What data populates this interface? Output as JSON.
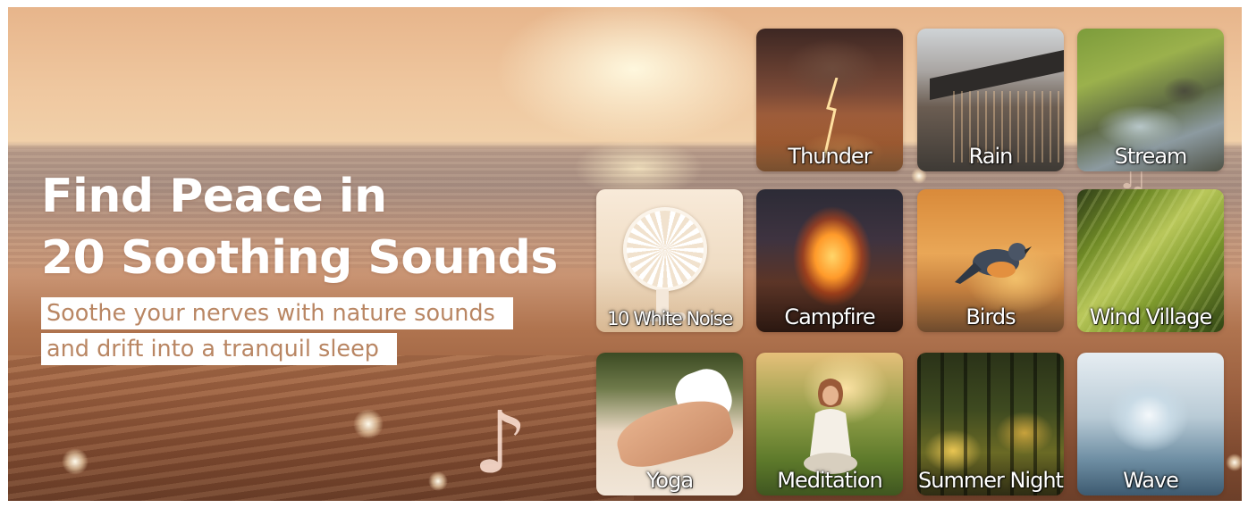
{
  "headline": {
    "line1": "Find Peace in",
    "line2": "20 Soothing Sounds"
  },
  "subtitle": {
    "line1": "Soothe your nerves with nature sounds",
    "line2": "and drift into a tranquil sleep"
  },
  "tiles": [
    {
      "label": "Thunder",
      "icon": "thunder-icon"
    },
    {
      "label": "Rain",
      "icon": "rain-icon"
    },
    {
      "label": "Stream",
      "icon": "stream-icon"
    },
    {
      "label": "10 White Noise",
      "icon": "fan-icon"
    },
    {
      "label": "Campfire",
      "icon": "campfire-icon"
    },
    {
      "label": "Birds",
      "icon": "bird-icon"
    },
    {
      "label": "Wind Village",
      "icon": "wind-icon"
    },
    {
      "label": "Yoga",
      "icon": "yoga-icon"
    },
    {
      "label": "Meditation",
      "icon": "meditation-icon"
    },
    {
      "label": "Summer Night",
      "icon": "summer-night-icon"
    },
    {
      "label": "Wave",
      "icon": "wave-icon"
    }
  ],
  "colors": {
    "headline_text": "#ffffff",
    "subtitle_text": "#b98663",
    "subtitle_background": "#ffffff"
  }
}
